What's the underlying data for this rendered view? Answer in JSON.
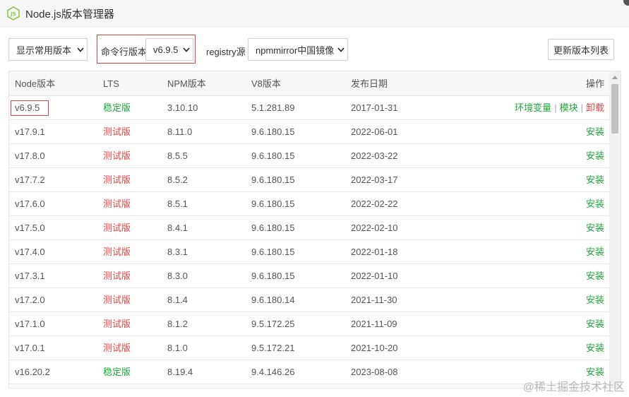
{
  "window": {
    "title": "Node.js版本管理器"
  },
  "toolbar": {
    "display_select": "显示常用版本",
    "cmd_label": "命令行版本",
    "cmd_select": "v6.9.5",
    "registry_label": "registry源",
    "registry_select": "npmmirror中国镜像",
    "refresh_button": "更新版本列表"
  },
  "table": {
    "headers": {
      "version": "Node版本",
      "lts": "LTS",
      "npm": "NPM版本",
      "v8": "V8版本",
      "date": "发布日期",
      "ops": "操作"
    },
    "ops_labels": {
      "env": "环境变量",
      "modules": "模块",
      "uninstall": "卸载",
      "install": "安装",
      "separator": "|"
    },
    "rows": [
      {
        "version": "v6.9.5",
        "lts": "稳定版",
        "lts_type": "stable",
        "npm": "3.10.10",
        "v8": "5.1.281.89",
        "date": "2017-01-31",
        "installed": true
      },
      {
        "version": "v17.9.1",
        "lts": "测试版",
        "lts_type": "beta",
        "npm": "8.11.0",
        "v8": "9.6.180.15",
        "date": "2022-06-01",
        "installed": false
      },
      {
        "version": "v17.8.0",
        "lts": "测试版",
        "lts_type": "beta",
        "npm": "8.5.5",
        "v8": "9.6.180.15",
        "date": "2022-03-22",
        "installed": false
      },
      {
        "version": "v17.7.2",
        "lts": "测试版",
        "lts_type": "beta",
        "npm": "8.5.2",
        "v8": "9.6.180.15",
        "date": "2022-03-17",
        "installed": false
      },
      {
        "version": "v17.6.0",
        "lts": "测试版",
        "lts_type": "beta",
        "npm": "8.5.1",
        "v8": "9.6.180.15",
        "date": "2022-02-22",
        "installed": false
      },
      {
        "version": "v17.5.0",
        "lts": "测试版",
        "lts_type": "beta",
        "npm": "8.4.1",
        "v8": "9.6.180.15",
        "date": "2022-02-10",
        "installed": false
      },
      {
        "version": "v17.4.0",
        "lts": "测试版",
        "lts_type": "beta",
        "npm": "8.3.1",
        "v8": "9.6.180.15",
        "date": "2022-01-18",
        "installed": false
      },
      {
        "version": "v17.3.1",
        "lts": "测试版",
        "lts_type": "beta",
        "npm": "8.3.0",
        "v8": "9.6.180.15",
        "date": "2022-01-10",
        "installed": false
      },
      {
        "version": "v17.2.0",
        "lts": "测试版",
        "lts_type": "beta",
        "npm": "8.1.4",
        "v8": "9.6.180.14",
        "date": "2021-11-30",
        "installed": false
      },
      {
        "version": "v17.1.0",
        "lts": "测试版",
        "lts_type": "beta",
        "npm": "8.1.2",
        "v8": "9.5.172.25",
        "date": "2021-11-09",
        "installed": false
      },
      {
        "version": "v17.0.1",
        "lts": "测试版",
        "lts_type": "beta",
        "npm": "8.1.0",
        "v8": "9.5.172.21",
        "date": "2021-10-20",
        "installed": false
      },
      {
        "version": "v16.20.2",
        "lts": "稳定版",
        "lts_type": "stable",
        "npm": "8.19.4",
        "v8": "9.4.146.26",
        "date": "2023-08-08",
        "installed": false
      }
    ]
  },
  "watermark": "@稀土掘金技术社区",
  "colors": {
    "stable": "#20a53a",
    "beta": "#e44444",
    "highlight": "#e24040"
  }
}
